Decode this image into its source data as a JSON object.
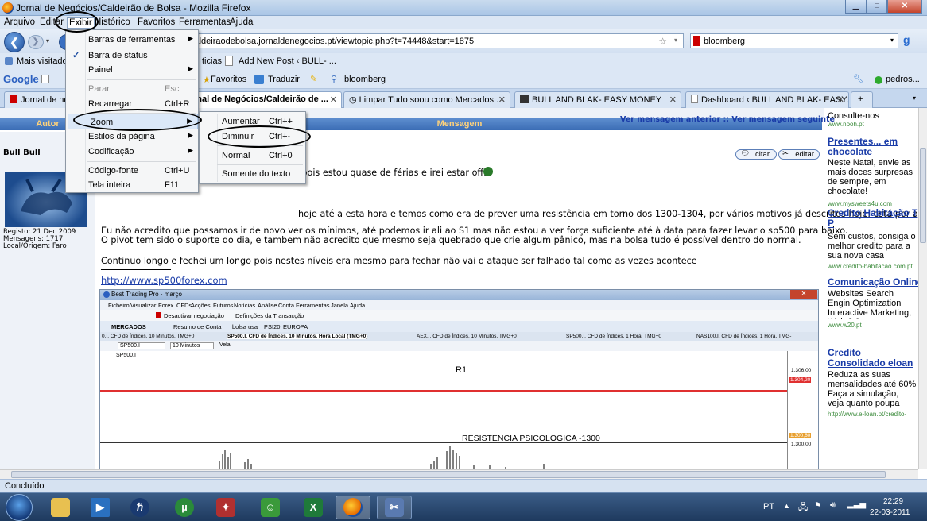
{
  "window": {
    "title": "Jornal de Negócios/Caldeirão de Bolsa - Mozilla Firefox"
  },
  "menubar": [
    "Arquivo",
    "Editar",
    "Exibir",
    "Histórico",
    "Favoritos",
    "Ferramentas",
    "Ajuda"
  ],
  "nav": {
    "url": "caldeiraodebolsa.jornaldenegocios.pt/viewtopic.php?t=74448&start=1875",
    "search_value": "bloomberg"
  },
  "bookmarks": [
    "Mais visitados",
    "ticias",
    "Add New Post ‹ BULL- ..."
  ],
  "googlebar": {
    "logo": "Google",
    "items": [
      "Favoritos",
      "Traduzir",
      "bloomberg"
    ],
    "user": "pedros..."
  },
  "tabs": [
    {
      "label": "Jornal de ne",
      "active": false
    },
    {
      "label": "rnal de Negócios/Caldeirão de ...",
      "active": true
    },
    {
      "label": "Limpar Tudo soou como Mercados ...",
      "active": false
    },
    {
      "label": "BULL AND BLAK- EASY MONEY",
      "active": false
    },
    {
      "label": "Dashboard ‹ BULL AND BLAK- EASY...",
      "active": false
    }
  ],
  "view_menu": {
    "items": [
      {
        "label": "Barras de ferramentas",
        "shortcut": "",
        "submenu": true,
        "checked": false,
        "disabled": false
      },
      {
        "label": "Barra de status",
        "shortcut": "",
        "submenu": false,
        "checked": true,
        "disabled": false
      },
      {
        "label": "Painel",
        "shortcut": "",
        "submenu": true,
        "checked": false,
        "disabled": false
      },
      {
        "label": "Parar",
        "shortcut": "Esc",
        "submenu": false,
        "checked": false,
        "disabled": true
      },
      {
        "label": "Recarregar",
        "shortcut": "Ctrl+R",
        "submenu": false,
        "checked": false,
        "disabled": false
      },
      {
        "label": "Zoom",
        "shortcut": "",
        "submenu": true,
        "checked": false,
        "disabled": false
      },
      {
        "label": "Estilos da página",
        "shortcut": "",
        "submenu": true,
        "checked": false,
        "disabled": false
      },
      {
        "label": "Codificação",
        "shortcut": "",
        "submenu": true,
        "checked": false,
        "disabled": false
      },
      {
        "label": "Código-fonte",
        "shortcut": "Ctrl+U",
        "submenu": false,
        "checked": false,
        "disabled": false
      },
      {
        "label": "Tela inteira",
        "shortcut": "F11",
        "submenu": false,
        "checked": false,
        "disabled": false
      }
    ]
  },
  "zoom_menu": {
    "items": [
      {
        "label": "Aumentar",
        "shortcut": "Ctrl++"
      },
      {
        "label": "Diminuir",
        "shortcut": "Ctrl+-"
      },
      {
        "label": "Normal",
        "shortcut": "Ctrl+0"
      },
      {
        "label": "Somente do texto",
        "shortcut": ""
      }
    ]
  },
  "forum": {
    "header_author": "Autor",
    "header_message": "Mensagem",
    "nav_links": "Ver mensagem anterior :: Ver mensagem seguinte",
    "author": "Bull Bull",
    "author_info": [
      "Registo: 21 Dec 2009",
      "Mensagens: 1717",
      "Local/Origem: Faro"
    ],
    "quote_btn": "citar",
    "edit_btn": "editar",
    "lines": [
      "ise pois estou quase de férias e irei estar off.",
      "hoje até a esta hora e temos como era de prever uma resistência em torno dos 1300-1304, por vários motivos já descritos hoje, está por ai o post.",
      "Eu não acredito que possamos ir de novo ver os mínimos, até podemos ir ali ao S1 mas não estou a ver força suficiente até à data para fazer levar o sp500 para baixo.",
      "O pivot tem sido o suporte do dia, e tambem não acredito que mesmo seja quebrado que crie algum pânico, mas na bolsa tudo é possível dentro do normal.",
      "Continuo longo e fechei um longo pois nestes níveis era mesmo para fechar não vai o ataque ser falhado tal como as vezes acontece"
    ],
    "signature_link": "http://www.sp500forex.com"
  },
  "embedded_app": {
    "title": "Best Trading Pro - março",
    "menu": [
      "Ficheiro",
      "Visualizar",
      "Forex",
      "CFDs",
      "Acções",
      "Futuros",
      "Notícias",
      "Análise",
      "Conta",
      "Ferramentas",
      "Janela",
      "Ajuda"
    ],
    "toolbar": [
      "Desactivar negociação",
      "Definições da Transacção"
    ],
    "tabs": [
      "MERCADOS",
      "Resumo de Conta",
      "bolsa usa",
      "PSI20",
      "EUROPA"
    ],
    "doc_tabs": [
      "0.I, CFD de Índices, 10 Minutos, TMG+0",
      "SP500.I, CFD de Índices, 10 Minutos, Hora Local (TMG+0)",
      "AEX.I, CFD de Índices, 10 Minutos, TMG+0",
      "SP500.I, CFD de Índices, 1 Hora, TMG+0",
      "NAS100.I, CFD de Índices, 1 Hora, TMG-"
    ],
    "symbol": "SP500.I",
    "interval": "10 Minutos",
    "chart_type": "Vela",
    "legend": "SP500.I",
    "r1_label": "R1",
    "res_label": "RESISTENCIA PSICOLOGICA -1300",
    "prices": [
      "1.306,00",
      "1.304,20",
      "1.300,60",
      "1.300,00"
    ]
  },
  "ads": [
    {
      "title": "",
      "text": "Consulte-nos",
      "url": "www.nooh.pt"
    },
    {
      "title": "Presentes... em chocolate",
      "text": "Neste Natal, envie as mais doces surpresas de sempre, em chocolate!",
      "url": "www.mysweets4u.com"
    },
    {
      "title": "Credito Habitação T P",
      "text": "Sem custos, consiga o melhor credito para a sua nova casa",
      "url": "www.credito-habitacao.com.pt"
    },
    {
      "title": "Comunicação Online",
      "text": "Websites Search Engin Optimization Interactive Marketing, Web 2.0",
      "url": "www.w20.pt"
    },
    {
      "title": "Credito Consolidado eloan",
      "text": "Reduza as suas mensalidades até 60% Faça a simulação, veja quanto poupa",
      "url": "http://www.e-loan.pt/credito-"
    }
  ],
  "statusbar": {
    "text": "Concluído"
  },
  "taskbar": {
    "lang": "PT",
    "time": "22:29",
    "date": "22-03-2011"
  },
  "colors": {
    "titlebar": "#b4cce8",
    "forum_header": "#4a7cc4",
    "link": "#1a3ca8",
    "resistance_line": "#e03030"
  }
}
